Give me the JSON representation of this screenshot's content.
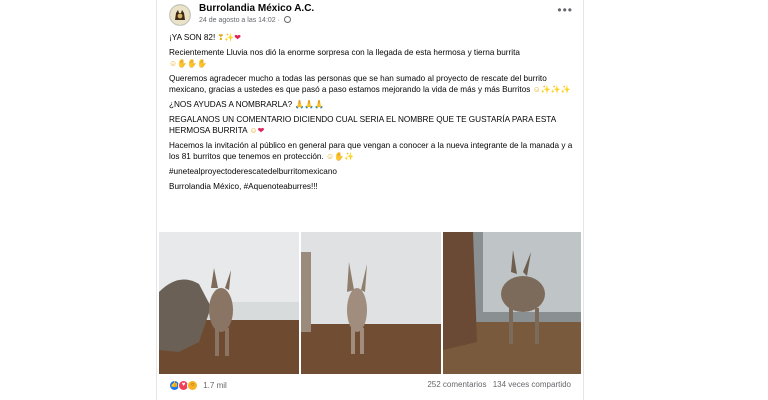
{
  "post": {
    "page_name": "Burrolandia México A.C.",
    "date": "24 de agosto a las 14:02",
    "meta_separator": "·",
    "more_label": "•••",
    "paragraphs": {
      "p1": "¡YA SON 82!",
      "p2": "Recientemente Lluvia nos dió la enorme sorpresa con la llegada de esta hermosa y tierna burrita",
      "p3": "Queremos agradecer mucho a todas las personas que se han sumado al proyecto de rescate del burrito mexicano, gracias a ustedes es que pasó a paso estamos mejorando la vida de más y más Burritos",
      "p4": "¿NOS AYUDAS A NOMBRARLA?",
      "p5": "REGALANOS UN COMENTARIO DICIENDO CUAL SERIA EL NOMBRE QUE TE GUSTARÍA PARA ESTA HERMOSA BURRITA",
      "p6": "Hacemos la invitación al público en general para que vengan a conocer a la nueva integrante de la manada y a los 81 burritos que tenemos en protección.",
      "p7": "#unetealproyectoderescatedelburritomexicano",
      "p8": "Burrolandia México, #Aquenoteaburres!!!"
    },
    "emojis": {
      "e1a": "❣",
      "e1b": "✨",
      "e1c": "❤",
      "e2a": "☺",
      "e2b": "✋",
      "e2c": "✋",
      "e2d": "✋",
      "e3a": "☺",
      "e3b": "✨",
      "e3c": "✨",
      "e3d": "✨",
      "e4a": "🙏",
      "e4b": "🙏",
      "e4c": "🙏",
      "e5a": "☺",
      "e5b": "❤",
      "e6a": "☺",
      "e6b": "✋",
      "e6c": "✨"
    },
    "photos": [
      "photo-1",
      "photo-2",
      "photo-3"
    ]
  },
  "footer": {
    "reaction_icons": [
      "like-icon",
      "love-icon",
      "wow-icon"
    ],
    "reaction_count": "1.7 mil",
    "comments": "252 comentarios",
    "shares": "134 veces compartido"
  },
  "colors": {
    "text": "#050505",
    "secondary": "#65676b",
    "like": "#1877f2",
    "love": "#f33e58"
  }
}
